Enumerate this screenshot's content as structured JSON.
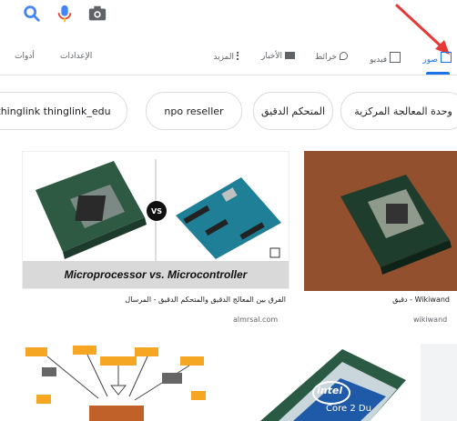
{
  "tabs": [
    {
      "label": "صور",
      "icon": "image-icon",
      "active": true
    },
    {
      "label": "فيديو",
      "icon": "video-icon"
    },
    {
      "label": "خرائط",
      "icon": "map-pin-icon"
    },
    {
      "label": "الأخبار",
      "icon": "news-icon"
    },
    {
      "label": "المزيد",
      "icon": "more-icon"
    },
    {
      "label": "الإعدادات"
    },
    {
      "label": "أدوات"
    }
  ],
  "chips": [
    {
      "label": "thinglink thinglink_edu"
    },
    {
      "label": "npo reseller"
    },
    {
      "label": "المتحكم الدقيق"
    },
    {
      "label": "وحدة المعالجة المركزية"
    }
  ],
  "results": [
    {
      "banner": "Microprocessor vs. Microcontroller",
      "vs": "VS",
      "caption": "الفرق بين المعالج الدقيق والمتحكم الدقيق - المرسال",
      "source": "almrsal.com"
    },
    {
      "caption": "Wikiwand - دقيق",
      "source": "wikiwand"
    },
    {
      "brand": "intel",
      "brand_sub": "Core 2 Du"
    }
  ],
  "colors": {
    "accent": "#1a73e8",
    "annotation": "#e53935"
  }
}
